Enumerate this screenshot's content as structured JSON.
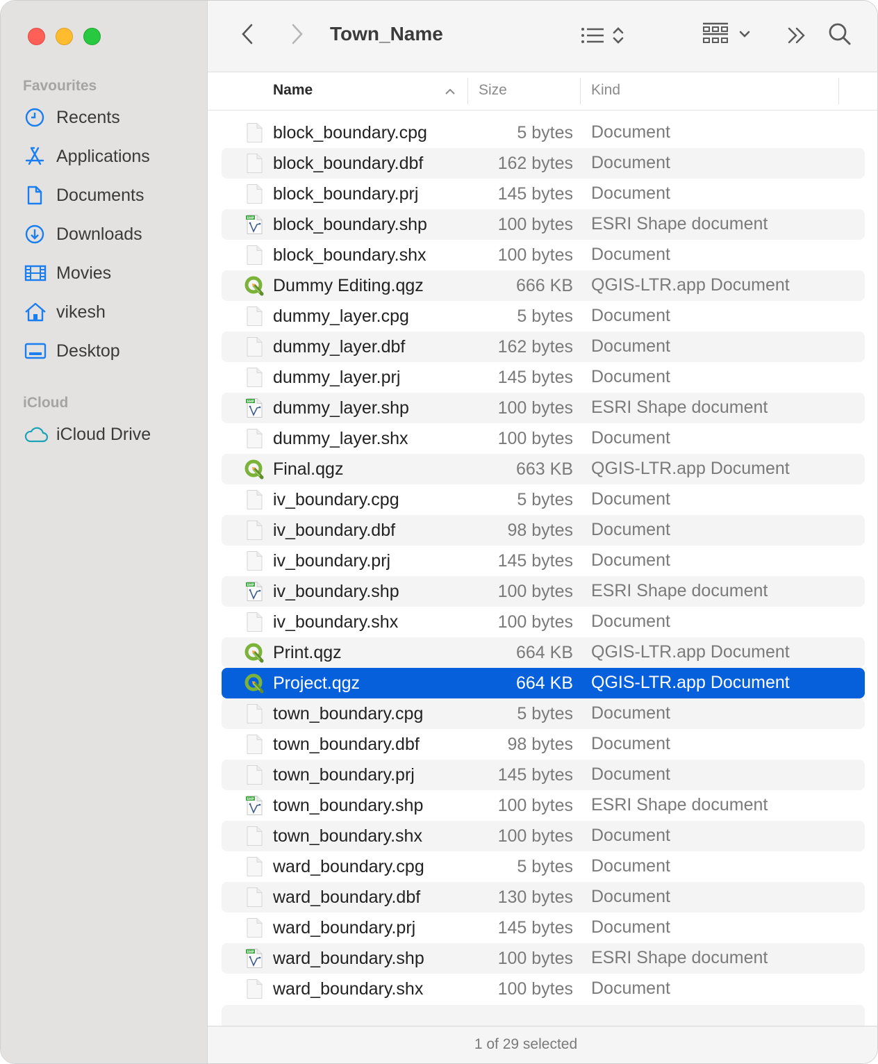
{
  "window": {
    "title": "Town_Name",
    "traffic_lights": {
      "close_color": "#fe5f57",
      "minimize_color": "#febc2e",
      "maximize_color": "#28c840"
    }
  },
  "sidebar": {
    "sections": [
      {
        "label": "Favourites"
      },
      {
        "label": "iCloud"
      }
    ],
    "favourites": [
      {
        "label": "Recents",
        "icon": "clock-icon"
      },
      {
        "label": "Applications",
        "icon": "applications-icon"
      },
      {
        "label": "Documents",
        "icon": "document-icon"
      },
      {
        "label": "Downloads",
        "icon": "download-icon"
      },
      {
        "label": "Movies",
        "icon": "film-icon"
      },
      {
        "label": "vikesh",
        "icon": "home-icon"
      },
      {
        "label": "Desktop",
        "icon": "desktop-icon"
      }
    ],
    "icloud": [
      {
        "label": "iCloud Drive",
        "icon": "cloud-icon"
      }
    ],
    "accent_color": "#1a7ef0"
  },
  "toolbar": {
    "back_icon": "chevron-left-icon",
    "forward_icon": "chevron-right-icon",
    "view_icon": "list-view-icon",
    "group_icon": "group-grid-icon",
    "more_icon": "double-chevron-right-icon",
    "search_icon": "search-icon"
  },
  "columns": {
    "name": "Name",
    "size": "Size",
    "kind": "Kind",
    "sort_indicator": "ascending"
  },
  "files": [
    {
      "name": "block_boundary.cpg",
      "size": "5 bytes",
      "kind": "Document",
      "type": "doc"
    },
    {
      "name": "block_boundary.dbf",
      "size": "162 bytes",
      "kind": "Document",
      "type": "doc"
    },
    {
      "name": "block_boundary.prj",
      "size": "145 bytes",
      "kind": "Document",
      "type": "doc"
    },
    {
      "name": "block_boundary.shp",
      "size": "100 bytes",
      "kind": "ESRI Shape document",
      "type": "shp"
    },
    {
      "name": "block_boundary.shx",
      "size": "100 bytes",
      "kind": "Document",
      "type": "doc"
    },
    {
      "name": "Dummy Editing.qgz",
      "size": "666 KB",
      "kind": "QGIS-LTR.app Document",
      "type": "qgz"
    },
    {
      "name": "dummy_layer.cpg",
      "size": "5 bytes",
      "kind": "Document",
      "type": "doc"
    },
    {
      "name": "dummy_layer.dbf",
      "size": "162 bytes",
      "kind": "Document",
      "type": "doc"
    },
    {
      "name": "dummy_layer.prj",
      "size": "145 bytes",
      "kind": "Document",
      "type": "doc"
    },
    {
      "name": "dummy_layer.shp",
      "size": "100 bytes",
      "kind": "ESRI Shape document",
      "type": "shp"
    },
    {
      "name": "dummy_layer.shx",
      "size": "100 bytes",
      "kind": "Document",
      "type": "doc"
    },
    {
      "name": "Final.qgz",
      "size": "663 KB",
      "kind": "QGIS-LTR.app Document",
      "type": "qgz"
    },
    {
      "name": "iv_boundary.cpg",
      "size": "5 bytes",
      "kind": "Document",
      "type": "doc"
    },
    {
      "name": "iv_boundary.dbf",
      "size": "98 bytes",
      "kind": "Document",
      "type": "doc"
    },
    {
      "name": "iv_boundary.prj",
      "size": "145 bytes",
      "kind": "Document",
      "type": "doc"
    },
    {
      "name": "iv_boundary.shp",
      "size": "100 bytes",
      "kind": "ESRI Shape document",
      "type": "shp"
    },
    {
      "name": "iv_boundary.shx",
      "size": "100 bytes",
      "kind": "Document",
      "type": "doc"
    },
    {
      "name": "Print.qgz",
      "size": "664 KB",
      "kind": "QGIS-LTR.app Document",
      "type": "qgz"
    },
    {
      "name": "Project.qgz",
      "size": "664 KB",
      "kind": "QGIS-LTR.app Document",
      "type": "qgz",
      "selected": true
    },
    {
      "name": "town_boundary.cpg",
      "size": "5 bytes",
      "kind": "Document",
      "type": "doc"
    },
    {
      "name": "town_boundary.dbf",
      "size": "98 bytes",
      "kind": "Document",
      "type": "doc"
    },
    {
      "name": "town_boundary.prj",
      "size": "145 bytes",
      "kind": "Document",
      "type": "doc"
    },
    {
      "name": "town_boundary.shp",
      "size": "100 bytes",
      "kind": "ESRI Shape document",
      "type": "shp"
    },
    {
      "name": "town_boundary.shx",
      "size": "100 bytes",
      "kind": "Document",
      "type": "doc"
    },
    {
      "name": "ward_boundary.cpg",
      "size": "5 bytes",
      "kind": "Document",
      "type": "doc"
    },
    {
      "name": "ward_boundary.dbf",
      "size": "130 bytes",
      "kind": "Document",
      "type": "doc"
    },
    {
      "name": "ward_boundary.prj",
      "size": "145 bytes",
      "kind": "Document",
      "type": "doc"
    },
    {
      "name": "ward_boundary.shp",
      "size": "100 bytes",
      "kind": "ESRI Shape document",
      "type": "shp"
    },
    {
      "name": "ward_boundary.shx",
      "size": "100 bytes",
      "kind": "Document",
      "type": "doc"
    }
  ],
  "selection_color": "#0660dc",
  "status_bar": {
    "text": "1 of 29 selected"
  }
}
